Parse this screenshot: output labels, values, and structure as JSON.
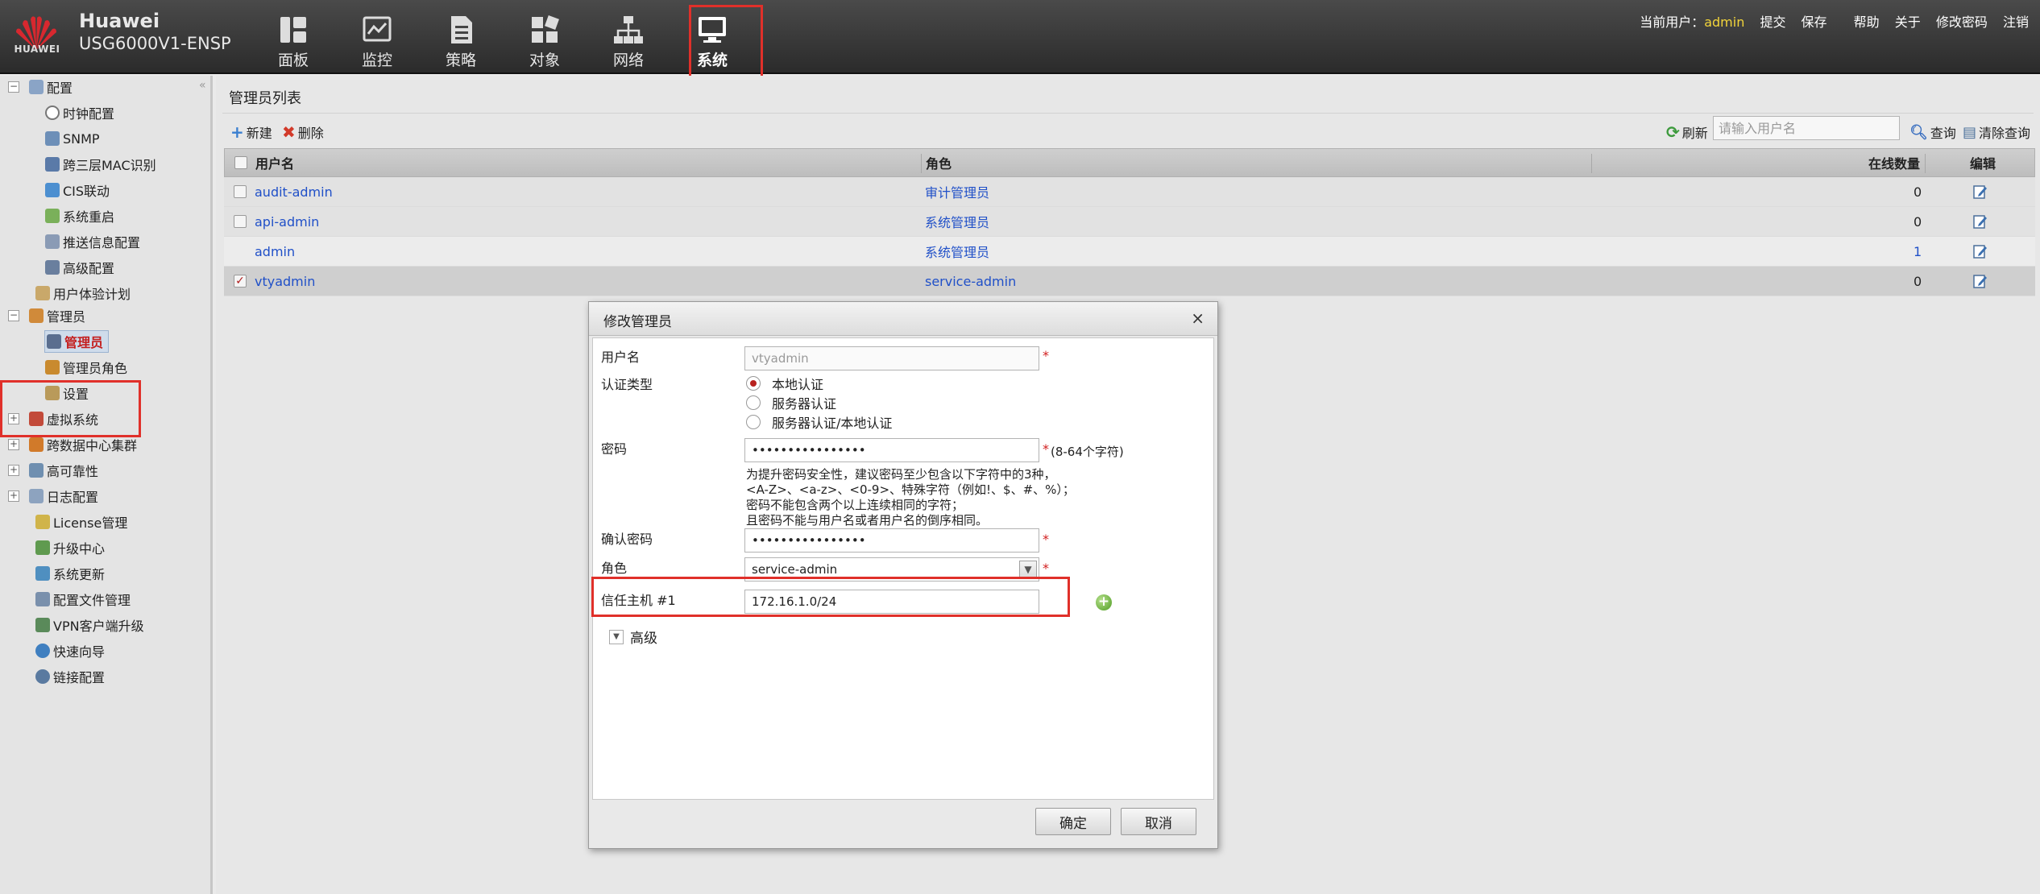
{
  "header": {
    "brand": "Huawei",
    "product": "USG6000V1-ENSP",
    "logo_text": "HUAWEI",
    "nav": [
      {
        "label": "面板",
        "icon": "dashboard-icon"
      },
      {
        "label": "监控",
        "icon": "monitor-icon"
      },
      {
        "label": "策略",
        "icon": "policy-icon"
      },
      {
        "label": "对象",
        "icon": "object-icon"
      },
      {
        "label": "网络",
        "icon": "network-icon"
      },
      {
        "label": "系统",
        "icon": "system-icon",
        "active": true
      }
    ],
    "user_label": "当前用户：",
    "user_name": "admin",
    "links": [
      "提交",
      "保存",
      "帮助",
      "关于",
      "修改密码",
      "注销"
    ]
  },
  "sidebar": {
    "collapse_glyph": "«",
    "items": [
      {
        "label": "配置",
        "toggle": "−",
        "level": 0
      },
      {
        "label": "时钟配置",
        "level": 1
      },
      {
        "label": "SNMP",
        "level": 1
      },
      {
        "label": "跨三层MAC识别",
        "level": 1
      },
      {
        "label": "CIS联动",
        "level": 1
      },
      {
        "label": "系统重启",
        "level": 1
      },
      {
        "label": "推送信息配置",
        "level": 1
      },
      {
        "label": "高级配置",
        "level": 1
      },
      {
        "label": "用户体验计划",
        "level": 0
      },
      {
        "label": "管理员",
        "toggle": "−",
        "level": 0
      },
      {
        "label": "管理员",
        "level": 1,
        "selected": true
      },
      {
        "label": "管理员角色",
        "level": 1
      },
      {
        "label": "设置",
        "level": 1
      },
      {
        "label": "虚拟系统",
        "toggle": "+",
        "level": 0
      },
      {
        "label": "跨数据中心集群",
        "toggle": "+",
        "level": 0
      },
      {
        "label": "高可靠性",
        "toggle": "+",
        "level": 0
      },
      {
        "label": "日志配置",
        "toggle": "+",
        "level": 0
      },
      {
        "label": "License管理",
        "level": 0
      },
      {
        "label": "升级中心",
        "level": 0
      },
      {
        "label": "系统更新",
        "level": 0
      },
      {
        "label": "配置文件管理",
        "level": 0
      },
      {
        "label": "VPN客户端升级",
        "level": 0
      },
      {
        "label": "快速向导",
        "level": 0
      },
      {
        "label": "链接配置",
        "level": 0
      }
    ]
  },
  "main": {
    "title": "管理员列表",
    "toolbar": {
      "new_label": "新建",
      "delete_label": "删除",
      "refresh_label": "刷新",
      "search_placeholder": "请输入用户名",
      "query_label": "查询",
      "clear_label": "清除查询"
    },
    "columns": {
      "username": "用户名",
      "role": "角色",
      "online": "在线数量",
      "edit": "编辑"
    },
    "rows": [
      {
        "username": "audit-admin",
        "role": "审计管理员",
        "online": "0",
        "checked": false
      },
      {
        "username": "api-admin",
        "role": "系统管理员",
        "online": "0",
        "checked": false
      },
      {
        "username": "admin",
        "role": "系统管理员",
        "online": "1",
        "checked": false
      },
      {
        "username": "vtyadmin",
        "role": "service-admin",
        "online": "0",
        "checked": true
      }
    ]
  },
  "dialog": {
    "title": "修改管理员",
    "close_glyph": "×",
    "username_label": "用户名",
    "username_value": "vtyadmin",
    "auth_label": "认证类型",
    "auth_options": [
      "本地认证",
      "服务器认证",
      "服务器认证/本地认证"
    ],
    "auth_selected": 0,
    "password_label": "密码",
    "password_value": "••••••••••••••••",
    "password_note": "(8-64个字符)",
    "password_hints": [
      "为提升密码安全性，建议密码至少包含以下字符中的3种，",
      "<A-Z>、<a-z>、<0-9>、特殊字符（例如!、$、#、%）；",
      "密码不能包含两个以上连续相同的字符；",
      "且密码不能与用户名或者用户名的倒序相同。"
    ],
    "confirm_label": "确认密码",
    "confirm_value": "••••••••••••••••",
    "role_label": "角色",
    "role_value": "service-admin",
    "trusted_host_label": "信任主机 #1",
    "trusted_host_value": "172.16.1.0/24",
    "advanced_label": "高级",
    "ok_label": "确定",
    "cancel_label": "取消",
    "required_mark": "*"
  },
  "colors": {
    "highlight": "#e0302a",
    "link": "#2050c8",
    "username": "#f2d43a"
  }
}
